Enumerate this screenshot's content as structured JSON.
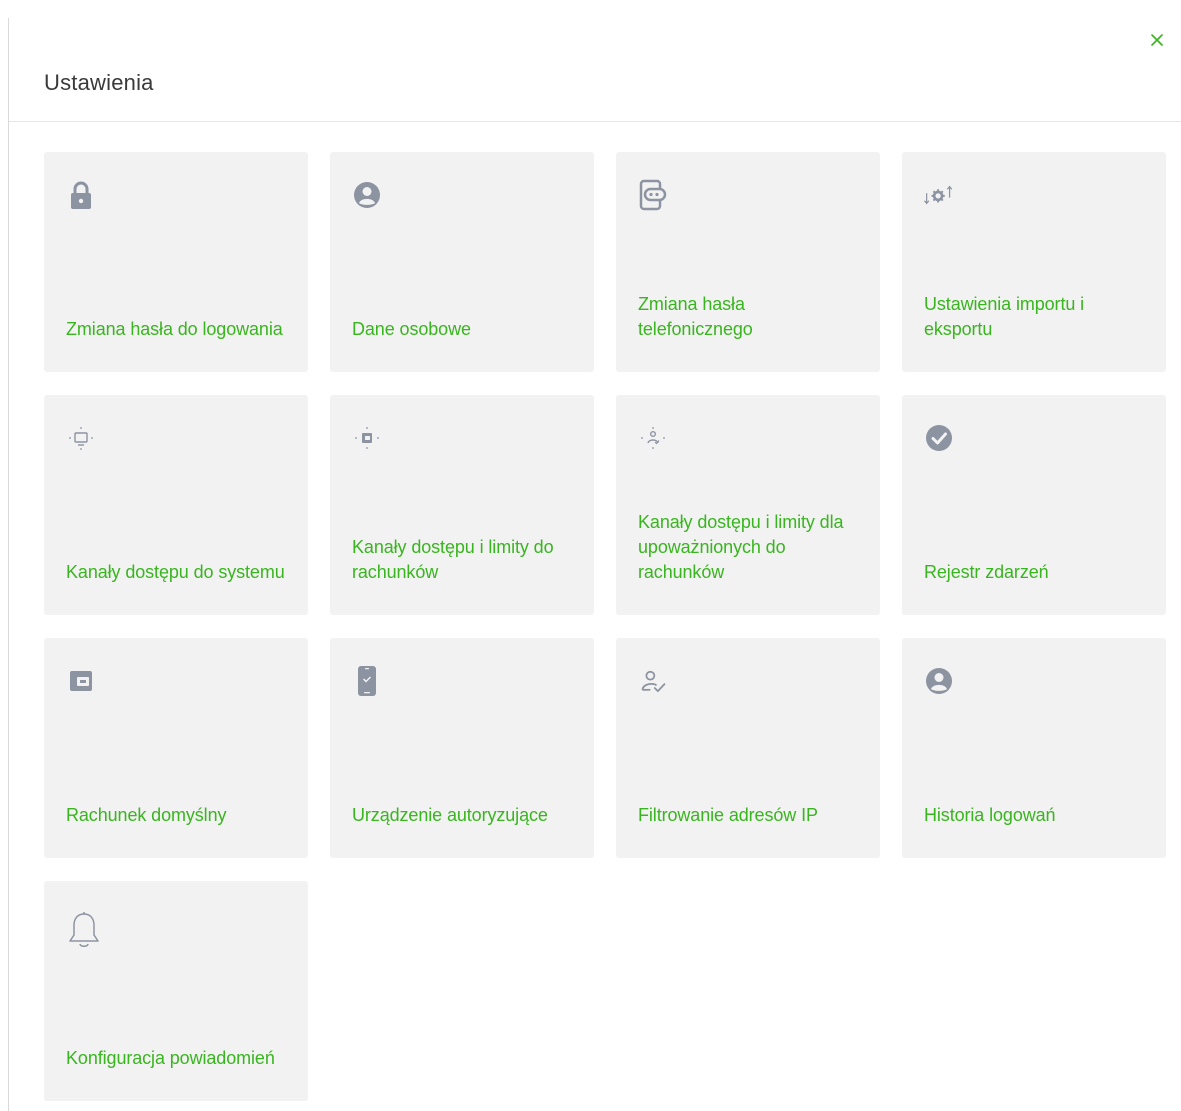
{
  "modal": {
    "title": "Ustawienia",
    "close_icon": "close-icon"
  },
  "colors": {
    "accent_green": "#39b51f",
    "tile_background": "#f2f2f2",
    "icon_gray": "#8c93a1"
  },
  "tiles": [
    {
      "label": "Zmiana hasła do logowania",
      "icon": "lock-icon"
    },
    {
      "label": "Dane osobowe",
      "icon": "user-circle-icon"
    },
    {
      "label": "Zmiana hasła telefonicznego",
      "icon": "phone-password-icon"
    },
    {
      "label": "Ustawienia importu i eksportu",
      "icon": "import-export-gear-icon"
    },
    {
      "label": "Kanały dostępu do systemu",
      "icon": "monitor-channels-icon"
    },
    {
      "label": "Kanały dostępu i limity do rachunków",
      "icon": "wallet-channels-icon"
    },
    {
      "label": "Kanały dostępu i limity dla upoważnionych do rachunków",
      "icon": "user-channels-icon"
    },
    {
      "label": "Rejestr zdarzeń",
      "icon": "check-circle-icon"
    },
    {
      "label": "Rachunek domyślny",
      "icon": "wallet-icon"
    },
    {
      "label": "Urządzenie autoryzujące",
      "icon": "mobile-device-icon"
    },
    {
      "label": "Filtrowanie adresów IP",
      "icon": "user-check-icon"
    },
    {
      "label": "Historia logowań",
      "icon": "user-circle-icon"
    },
    {
      "label": "Konfiguracja powiadomień",
      "icon": "bell-icon"
    }
  ]
}
